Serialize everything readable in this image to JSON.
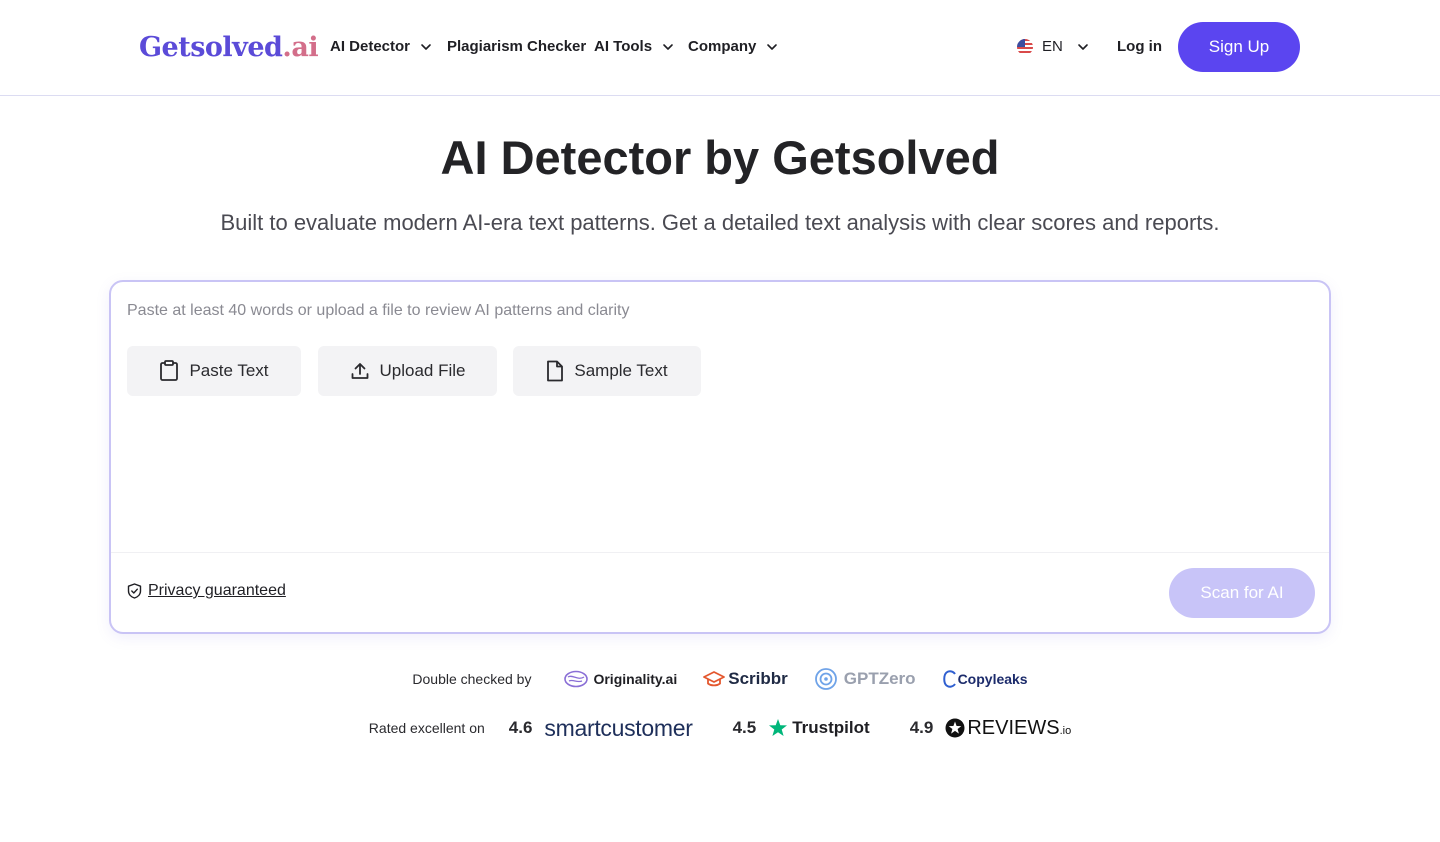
{
  "header": {
    "logo_main": "Getsolved",
    "logo_suffix": ".ai",
    "nav": [
      {
        "label": "AI Detector",
        "has_dropdown": true
      },
      {
        "label": "Plagiarism Checker",
        "has_dropdown": false
      },
      {
        "label": "AI Tools",
        "has_dropdown": true
      },
      {
        "label": "Company",
        "has_dropdown": true
      }
    ],
    "language": "EN",
    "login_label": "Log in",
    "signup_label": "Sign Up"
  },
  "hero": {
    "title": "AI Detector by Getsolved",
    "subtitle": "Built to evaluate modern AI-era text patterns. Get a detailed text analysis with clear scores and reports."
  },
  "editor": {
    "placeholder": "Paste at least 40 words or upload a file to review AI patterns and clarity",
    "paste_label": "Paste Text",
    "upload_label": "Upload File",
    "sample_label": "Sample Text",
    "privacy_label": "Privacy guaranteed",
    "scan_label": "Scan for AI"
  },
  "trust": {
    "checked_label": "Double checked by",
    "checkers": [
      "Originality.ai",
      "Scribbr",
      "GPTZero",
      "Copyleaks"
    ],
    "rated_label": "Rated excellent on",
    "ratings": [
      {
        "score": "4.6",
        "site": "smartcustomer"
      },
      {
        "score": "4.5",
        "site": "Trustpilot"
      },
      {
        "score": "4.9",
        "site": "REVIEWS",
        "suffix": ".io"
      }
    ]
  },
  "colors": {
    "primary": "#5b45f0",
    "primary_disabled": "#c8c4f8",
    "card_border": "#c9c4f5",
    "trustpilot_green": "#00b67a"
  }
}
